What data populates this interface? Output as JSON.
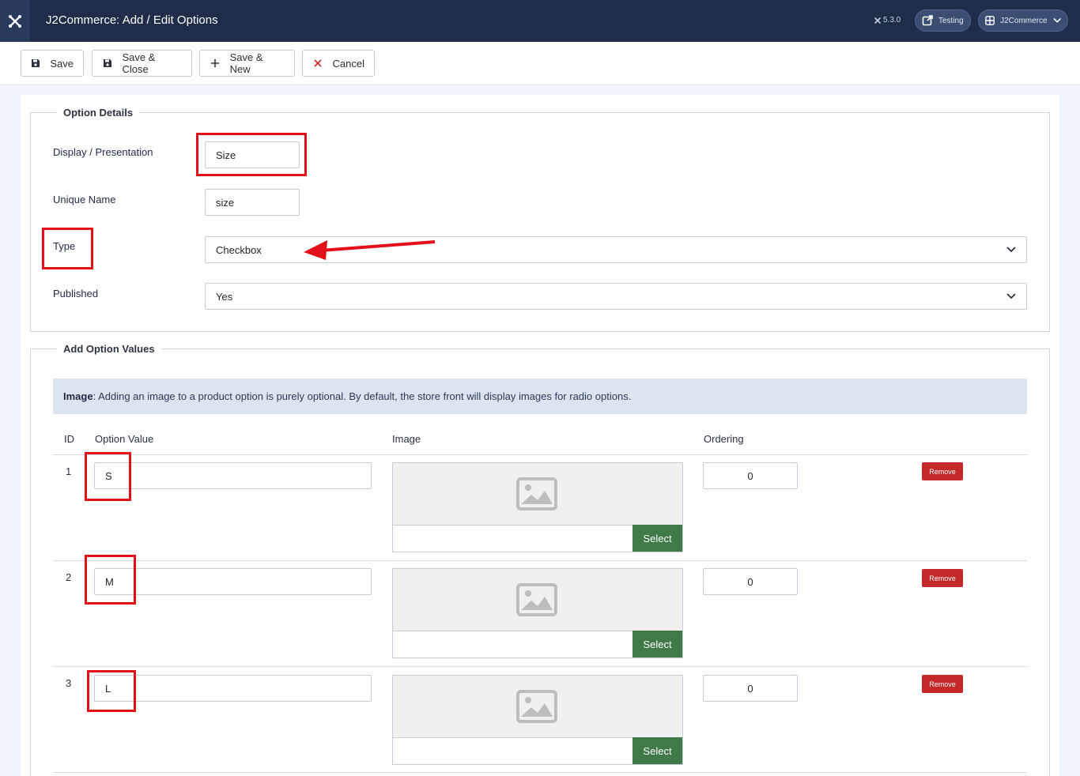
{
  "header": {
    "title": "J2Commerce: Add / Edit Options",
    "version": "5.3.0",
    "testing_label": "Testing",
    "j2commerce_label": "J2Commerce"
  },
  "toolbar": {
    "save_label": "Save",
    "save_close_label": "Save & Close",
    "save_new_label": "Save & New",
    "cancel_label": "Cancel"
  },
  "option_details": {
    "legend": "Option Details",
    "display_label": "Display / Presentation",
    "display_value": "Size",
    "unique_label": "Unique Name",
    "unique_value": "size",
    "type_label": "Type",
    "type_value": "Checkbox",
    "published_label": "Published",
    "published_value": "Yes"
  },
  "option_values": {
    "legend": "Add Option Values",
    "alert_bold": "Image",
    "alert_text": ": Adding an image to a product option is purely optional. By default, the store front will display images for radio options.",
    "columns": [
      "ID",
      "Option Value",
      "Image",
      "Ordering"
    ],
    "select_label": "Select",
    "remove_label": "Remove",
    "rows": [
      {
        "id": "1",
        "value": "S",
        "ordering": "0"
      },
      {
        "id": "2",
        "value": "M",
        "ordering": "0"
      },
      {
        "id": "3",
        "value": "L",
        "ordering": "0"
      }
    ]
  },
  "colors": {
    "header_bg": "#1f2d4a",
    "select_button": "#3f7a48",
    "remove_button": "#c52828",
    "annotation_red": "#e3101a"
  }
}
